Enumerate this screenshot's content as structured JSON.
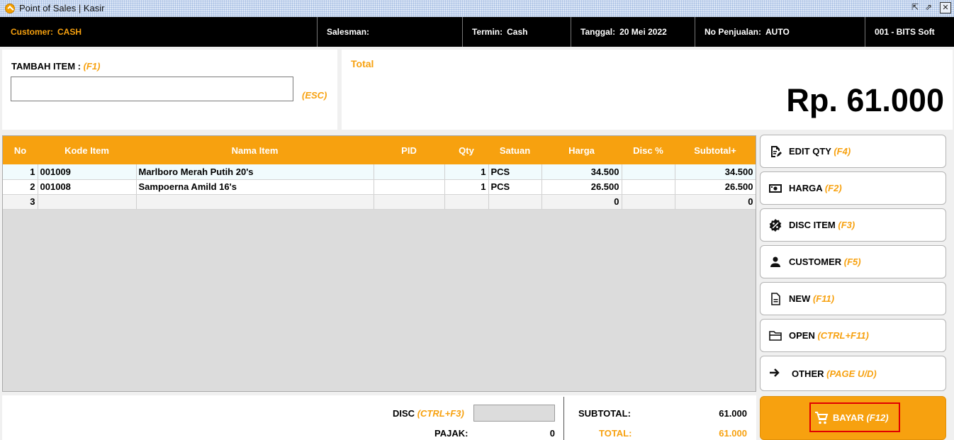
{
  "window": {
    "title": "Point of Sales | Kasir",
    "restore_glyph": "⇱",
    "popout_glyph": "⇗",
    "close_glyph": "✕"
  },
  "header": {
    "customer_label": "Customer:",
    "customer_value": "CASH",
    "salesman_label": "Salesman:",
    "salesman_value": "",
    "termin_label": "Termin:",
    "termin_value": "Cash",
    "tanggal_label": "Tanggal:",
    "tanggal_value": "20 Mei 2022",
    "no_label": "No Penjualan:",
    "no_value": "AUTO",
    "company": "001 - BITS Soft"
  },
  "add_item": {
    "label": "TAMBAH ITEM :",
    "key": "(F1)",
    "value": "",
    "esc": "(ESC)"
  },
  "total": {
    "label": "Total",
    "amount": "Rp. 61.000"
  },
  "table": {
    "columns": [
      "No",
      "Kode Item",
      "Nama Item",
      "PID",
      "Qty",
      "Satuan",
      "Harga",
      "Disc %",
      "Subtotal+"
    ],
    "rows": [
      {
        "no": "1",
        "kode": "001009",
        "nama": "Marlboro Merah Putih 20's",
        "pid": "",
        "qty": "1",
        "satuan": "PCS",
        "harga": "34.500",
        "disc": "",
        "subtotal": "34.500"
      },
      {
        "no": "2",
        "kode": "001008",
        "nama": "Sampoerna Amild 16's",
        "pid": "",
        "qty": "1",
        "satuan": "PCS",
        "harga": "26.500",
        "disc": "",
        "subtotal": "26.500"
      },
      {
        "no": "3",
        "kode": "",
        "nama": "",
        "pid": "",
        "qty": "",
        "satuan": "",
        "harga": "0",
        "disc": "",
        "subtotal": "0"
      }
    ]
  },
  "actions": [
    {
      "label": "EDIT QTY",
      "key": "(F4)",
      "icon": "edit-qty-icon"
    },
    {
      "label": "HARGA",
      "key": "(F2)",
      "icon": "cash-icon"
    },
    {
      "label": "DISC ITEM",
      "key": "(F3)",
      "icon": "discount-icon"
    },
    {
      "label": "CUSTOMER",
      "key": "(F5)",
      "icon": "person-icon"
    },
    {
      "label": "NEW",
      "key": "(F11)",
      "icon": "document-icon"
    },
    {
      "label": "OPEN",
      "key": "(CTRL+F11)",
      "icon": "folder-icon"
    },
    {
      "label": "OTHER",
      "key": "(PAGE U/D)",
      "icon": "arrow-right-icon"
    }
  ],
  "bayar": {
    "label": "BAYAR",
    "key": "(F12)",
    "icon": "cart-icon"
  },
  "footer": {
    "disc_label": "DISC",
    "disc_key": "(CTRL+F3)",
    "disc_value": "",
    "pajak_label": "PAJAK:",
    "pajak_value": "0",
    "subtotal_label": "SUBTOTAL:",
    "subtotal_value": "61.000",
    "total_label": "TOTAL:",
    "total_value": "61.000"
  },
  "colors": {
    "accent": "#f7a10f",
    "header_bg": "#000000",
    "highlight_border": "#e00000"
  }
}
